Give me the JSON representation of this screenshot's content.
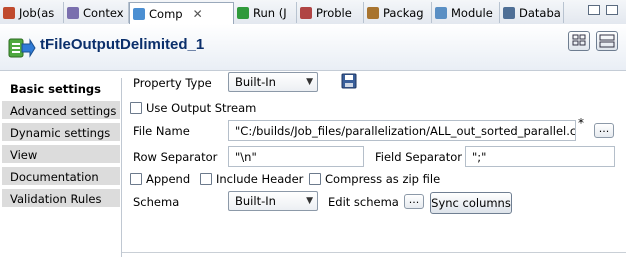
{
  "tabs": [
    {
      "label": "Job(as",
      "icon": "job-icon",
      "color": "#c04a2e"
    },
    {
      "label": "Contex",
      "icon": "contexts-icon",
      "color": "#7a6fae"
    },
    {
      "label": "Comp",
      "icon": "component-icon",
      "color": "#4b8fd2",
      "active": true
    },
    {
      "label": "Run (J",
      "icon": "run-icon",
      "color": "#2f9a3b"
    },
    {
      "label": "Proble",
      "icon": "problems-icon",
      "color": "#b04444"
    },
    {
      "label": "Packag",
      "icon": "package-icon",
      "color": "#a8742f"
    },
    {
      "label": "Module",
      "icon": "module-icon",
      "color": "#5a8fc4"
    },
    {
      "label": "Databa",
      "icon": "database-icon",
      "color": "#4f6f96"
    }
  ],
  "component": {
    "title": "tFileOutputDelimited_1",
    "icon": "file-output-icon"
  },
  "nav": [
    {
      "label": "Basic settings",
      "active": true
    },
    {
      "label": "Advanced settings"
    },
    {
      "label": "Dynamic settings"
    },
    {
      "label": "View"
    },
    {
      "label": "Documentation"
    },
    {
      "label": "Validation Rules"
    }
  ],
  "form": {
    "property_type_label": "Property Type",
    "property_type_value": "Built-In",
    "use_output_stream_label": "Use Output Stream",
    "file_name_label": "File Name",
    "file_name_value": "\"C:/builds/Job_files/parallelization/ALL_out_sorted_parallel.csv\"",
    "file_name_required": "*",
    "row_separator_label": "Row Separator",
    "row_separator_value": "\"\\n\"",
    "field_separator_label": "Field Separator",
    "field_separator_value": "\";\"",
    "append_label": "Append",
    "include_header_label": "Include Header",
    "compress_label": "Compress as zip file",
    "schema_label": "Schema",
    "schema_value": "Built-In",
    "edit_schema_label": "Edit schema",
    "sync_columns_label": "Sync columns",
    "browse_label": "...",
    "edit_schema_button": "..."
  },
  "colors": {
    "accent_title": "#0b2f6b",
    "tab_border": "#a9b6c6",
    "nav_bg": "#dcdcdc"
  }
}
